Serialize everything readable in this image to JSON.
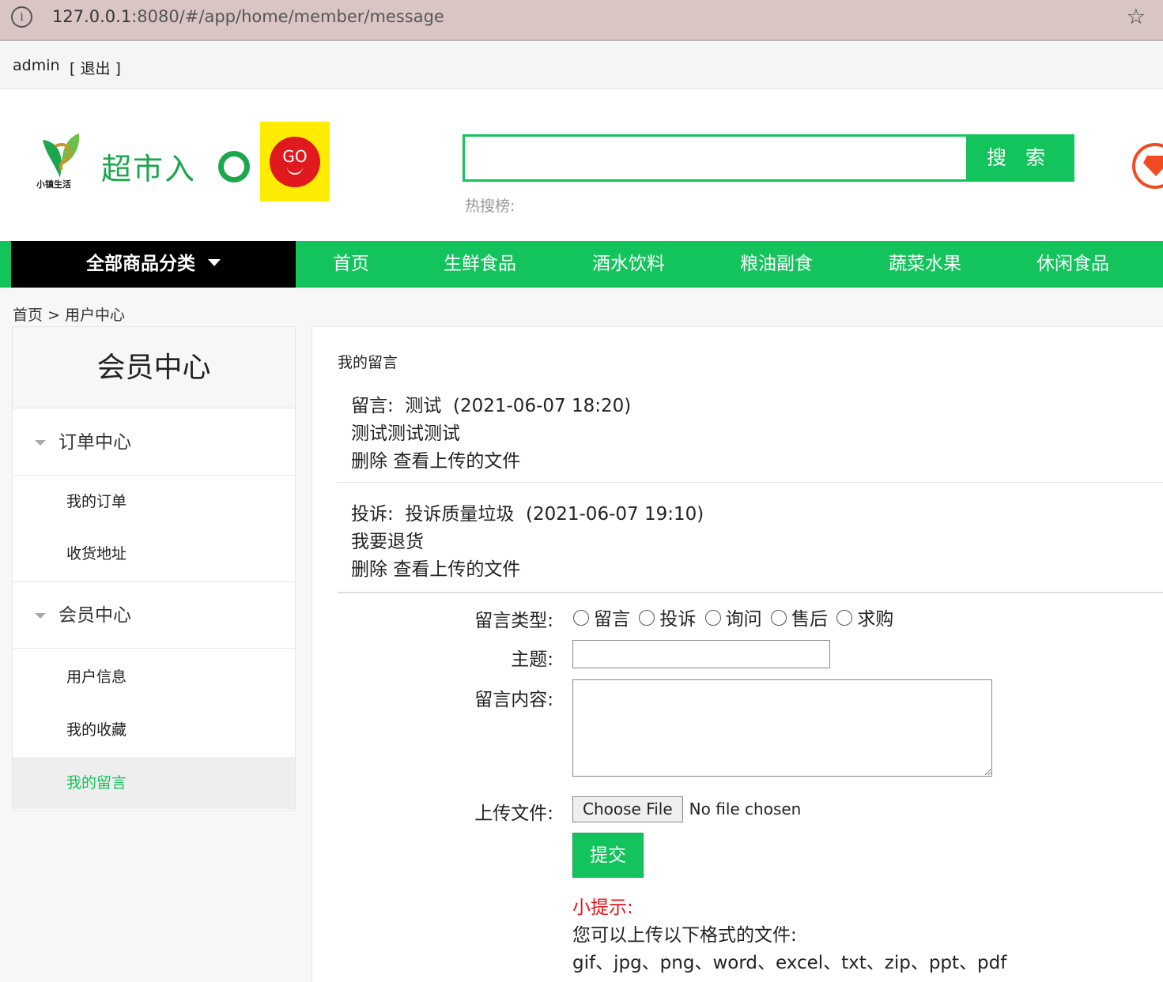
{
  "browser": {
    "url_host": "127.0.0.1",
    "url_rest": ":8080/#/app/home/member/message",
    "info_glyph": "i",
    "star_icon": "☆"
  },
  "userbar": {
    "username": "admin",
    "logout": "[ 退出 ]"
  },
  "header": {
    "logo_small": "小镇生活",
    "logo_text": "超市入",
    "go_text": "GO",
    "search_placeholder": "",
    "search_button": "搜 索",
    "hot_label": "热搜榜:"
  },
  "nav": {
    "all_categories": "全部商品分类",
    "items": [
      "首页",
      "生鲜食品",
      "酒水饮料",
      "粮油副食",
      "蔬菜水果",
      "休闲食品"
    ]
  },
  "breadcrumb": {
    "home": "首页",
    "sep": ">",
    "current": "用户中心"
  },
  "sidebar": {
    "title": "会员中心",
    "groups": [
      {
        "label": "订单中心",
        "links": [
          "我的订单",
          "收货地址"
        ]
      },
      {
        "label": "会员中心",
        "links": [
          "用户信息",
          "我的收藏",
          "我的留言"
        ]
      }
    ]
  },
  "main": {
    "heading": "我的留言",
    "messages": [
      {
        "type": "留言:",
        "subject": "测试",
        "time": "(2021-06-07 18:20)",
        "content": "测试测试测试",
        "delete": "删除",
        "view": "查看上传的文件"
      },
      {
        "type": "投诉:",
        "subject": "投诉质量垃圾",
        "time": "(2021-06-07 19:10)",
        "content": "我要退货",
        "delete": "删除",
        "view": "查看上传的文件"
      }
    ],
    "form": {
      "type_label": "留言类型:",
      "types": [
        "留言",
        "投诉",
        "询问",
        "售后",
        "求购"
      ],
      "subject_label": "主题:",
      "subject_value": "",
      "content_label": "留言内容:",
      "content_value": "",
      "file_label": "上传文件:",
      "file_button": "Choose File",
      "file_status": "No file chosen",
      "submit": "提交",
      "tip_title": "小提示:",
      "tip_line1": "您可以上传以下格式的文件:",
      "tip_line2": "gif、jpg、png、word、excel、txt、zip、ppt、pdf"
    }
  }
}
